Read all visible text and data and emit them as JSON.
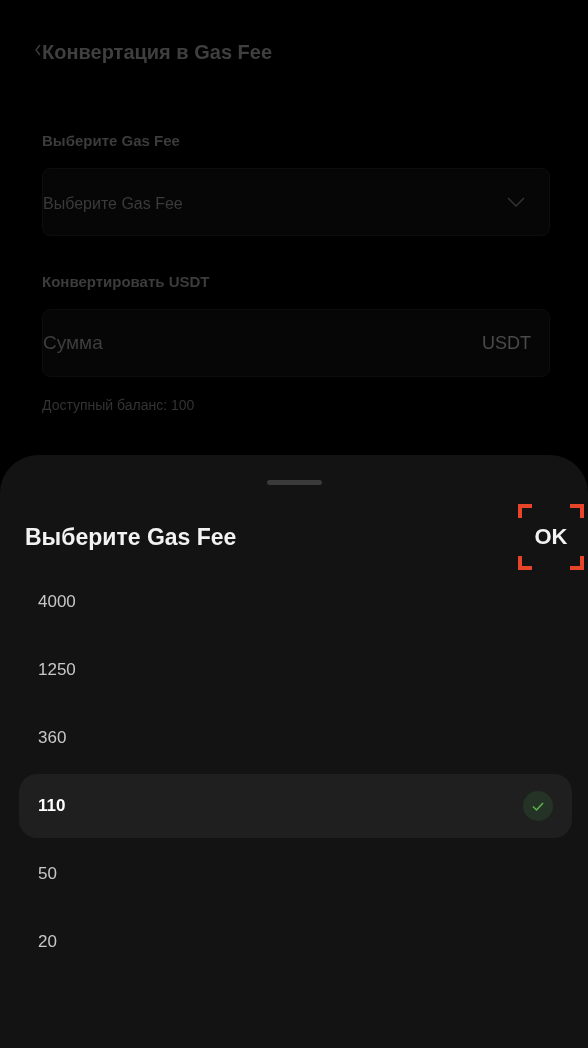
{
  "header": {
    "title": "Конвертация в Gas Fee"
  },
  "form": {
    "fee_label": "Выберите Gas Fee",
    "fee_placeholder": "Выберите Gas Fee",
    "amount_label": "Конвертировать USDT",
    "amount_placeholder": "Сумма",
    "amount_unit": "USDT",
    "balance": "Доступный баланс: 100"
  },
  "sheet": {
    "title": "Выберите Gas Fee",
    "ok": "OK",
    "options": [
      {
        "label": "4000",
        "selected": false
      },
      {
        "label": "1250",
        "selected": false
      },
      {
        "label": "360",
        "selected": false
      },
      {
        "label": "110",
        "selected": true
      },
      {
        "label": "50",
        "selected": false
      },
      {
        "label": "20",
        "selected": false
      }
    ]
  }
}
